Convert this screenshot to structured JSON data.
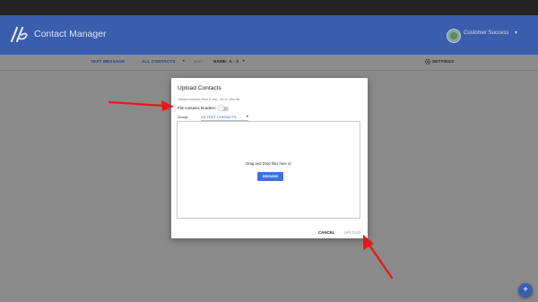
{
  "app": {
    "title": "Contact Manager",
    "user": "Customer Success"
  },
  "toolbar": {
    "text_message": "TEXT MESSAGE",
    "filter": "ALL CONTACTS",
    "sort_label": "Sort:",
    "sort_value": "NAME: A - Z",
    "settings": "SETTINGS"
  },
  "modal": {
    "title": "Upload Contacts",
    "subtitle": "Upload contacts from a .csv, .xls or .xlsx file.",
    "headers_label": "File contains headers:",
    "headers_enabled": false,
    "group_label": "Group:",
    "group_value": "CS TEXT CONTACTS",
    "dropzone_text": "Drag and Drop files here or",
    "browse_label": "BROWSE",
    "cancel_label": "CANCEL",
    "upload_label": "UPLOAD"
  },
  "fab": {
    "label": "+"
  },
  "colors": {
    "appbar": "#3b5dad",
    "accent": "#3d74d9",
    "annotation": "#e8161a"
  },
  "icons": [
    "logo-icon",
    "avatar-icon",
    "caret-down-icon",
    "gear-icon",
    "add-icon"
  ]
}
